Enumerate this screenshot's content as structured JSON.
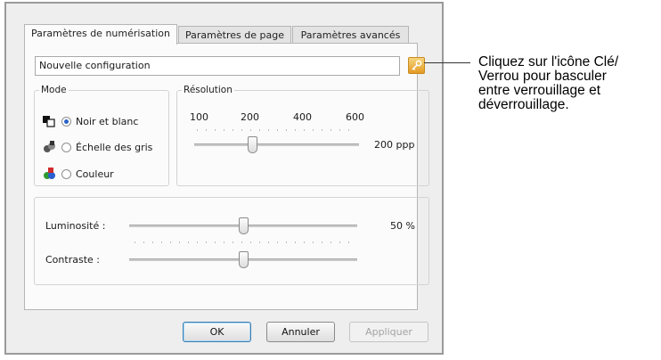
{
  "tabs": [
    {
      "label": "Paramètres de numérisation",
      "active": true
    },
    {
      "label": "Paramètres de page",
      "active": false
    },
    {
      "label": "Paramètres avancés",
      "active": false
    }
  ],
  "config_name": "Nouvelle configuration",
  "lock_icon": "key-lock-icon",
  "mode": {
    "title": "Mode",
    "options": [
      {
        "label": "Noir et blanc",
        "checked": true,
        "icon": "bw-icon"
      },
      {
        "label": "Échelle des gris",
        "checked": false,
        "icon": "grayscale-icon"
      },
      {
        "label": "Couleur",
        "checked": false,
        "icon": "color-icon"
      }
    ]
  },
  "resolution": {
    "title": "Résolution",
    "ticks": [
      "100",
      "200",
      "400",
      "600"
    ],
    "value_label": "200 ppp"
  },
  "brightness": {
    "label": "Luminosité :",
    "value_label": "50 %"
  },
  "contrast": {
    "label": "Contraste :"
  },
  "buttons": {
    "ok": "OK",
    "cancel": "Annuler",
    "apply": "Appliquer"
  },
  "callout": "Cliquez sur l'icône Clé/\nVerrou pour basculer\nentre verrouillage et\ndéverrouillage.",
  "colors": {
    "accent": "#2b62c8",
    "lock": "#e49a24"
  }
}
